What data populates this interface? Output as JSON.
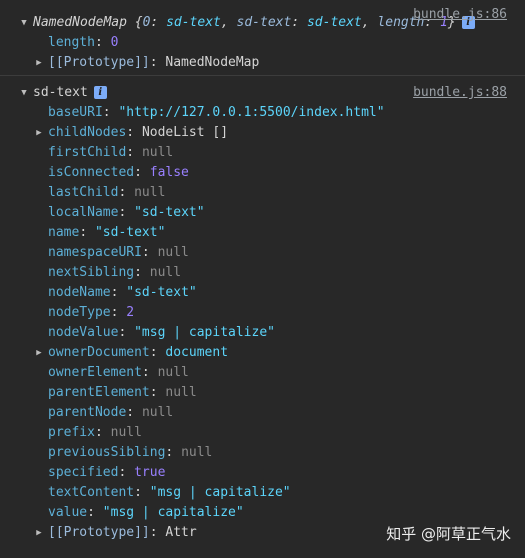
{
  "log1": {
    "source": "bundle.js:86",
    "summary_name": "NamedNodeMap",
    "summary_open": " {",
    "summary_k0": "0",
    "summary_v0": "sd-text",
    "summary_k1": "sd-text",
    "summary_v1": "sd-text",
    "summary_k2": "length",
    "summary_v2": "1",
    "summary_close": "}",
    "props": [
      {
        "key": "length",
        "value": "0",
        "type": "num"
      },
      {
        "key": "[[Prototype]]",
        "value": "NamedNodeMap",
        "type": "obj"
      }
    ]
  },
  "log2": {
    "source": "bundle.js:88",
    "title": "sd-text",
    "props": [
      {
        "key": "baseURI",
        "value": "\"http://127.0.0.1:5500/index.html\"",
        "type": "str"
      },
      {
        "key": "childNodes",
        "value": "NodeList []",
        "type": "obj"
      },
      {
        "key": "firstChild",
        "value": "null",
        "type": "nul"
      },
      {
        "key": "isConnected",
        "value": "false",
        "type": "kw"
      },
      {
        "key": "lastChild",
        "value": "null",
        "type": "nul"
      },
      {
        "key": "localName",
        "value": "\"sd-text\"",
        "type": "str"
      },
      {
        "key": "name",
        "value": "\"sd-text\"",
        "type": "str"
      },
      {
        "key": "namespaceURI",
        "value": "null",
        "type": "nul"
      },
      {
        "key": "nextSibling",
        "value": "null",
        "type": "nul"
      },
      {
        "key": "nodeName",
        "value": "\"sd-text\"",
        "type": "str"
      },
      {
        "key": "nodeType",
        "value": "2",
        "type": "num"
      },
      {
        "key": "nodeValue",
        "value": "\"msg | capitalize\"",
        "type": "str"
      },
      {
        "key": "ownerDocument",
        "value": "document",
        "type": "str"
      },
      {
        "key": "ownerElement",
        "value": "null",
        "type": "nul"
      },
      {
        "key": "parentElement",
        "value": "null",
        "type": "nul"
      },
      {
        "key": "parentNode",
        "value": "null",
        "type": "nul"
      },
      {
        "key": "prefix",
        "value": "null",
        "type": "nul"
      },
      {
        "key": "previousSibling",
        "value": "null",
        "type": "nul"
      },
      {
        "key": "specified",
        "value": "true",
        "type": "kw"
      },
      {
        "key": "textContent",
        "value": "\"msg | capitalize\"",
        "type": "str"
      },
      {
        "key": "value",
        "value": "\"msg | capitalize\"",
        "type": "str"
      },
      {
        "key": "[[Prototype]]",
        "value": "Attr",
        "type": "obj"
      }
    ]
  },
  "watermark": "知乎 @阿草正气水",
  "icons": {
    "expanded": "triangle-down-icon",
    "collapsed": "triangle-right-icon",
    "info": "info-icon"
  }
}
